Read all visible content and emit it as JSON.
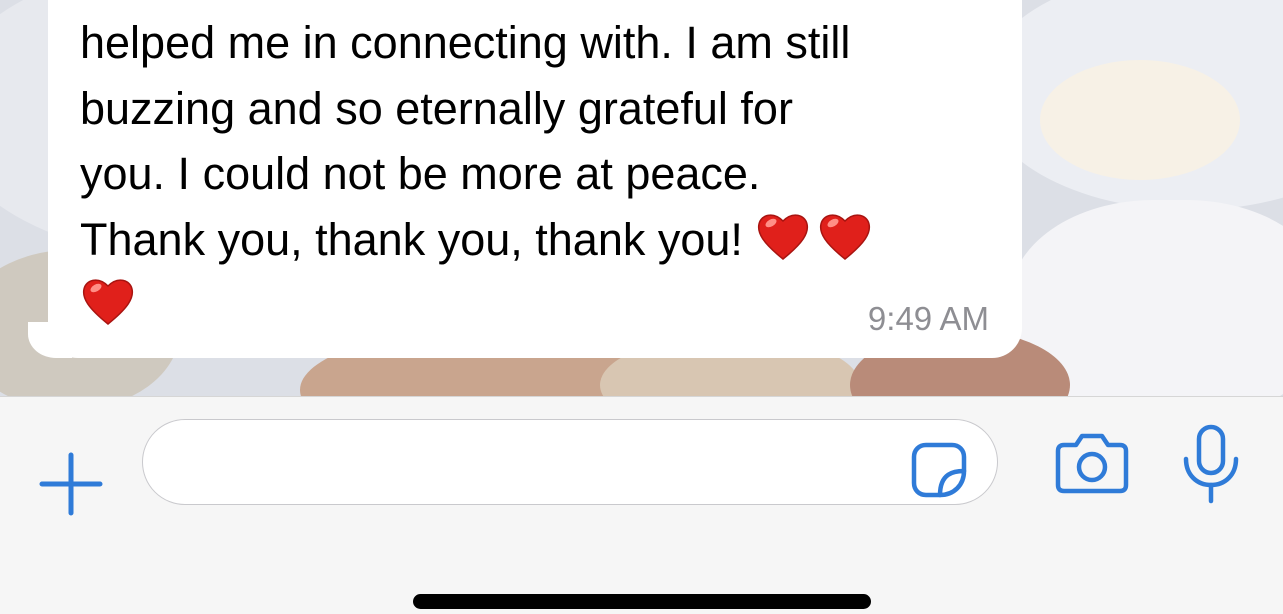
{
  "message": {
    "lines": [
      "helped me in connecting with. I am still",
      "buzzing and so eternally grateful for",
      "you. I could not be more at peace.",
      "Thank you, thank you, thank you!"
    ],
    "emoji": [
      "red-heart",
      "red-heart",
      "red-heart"
    ],
    "time": "9:49 AM"
  },
  "composer": {
    "value": "",
    "placeholder": "",
    "icons": {
      "attach": "plus-icon",
      "sticker": "sticker-icon",
      "camera": "camera-icon",
      "mic": "microphone-icon"
    }
  },
  "colors": {
    "accent": "#2f7bd8",
    "bubble": "#ffffff",
    "timestamp": "#8e8e93",
    "heart": "#e0201b"
  }
}
